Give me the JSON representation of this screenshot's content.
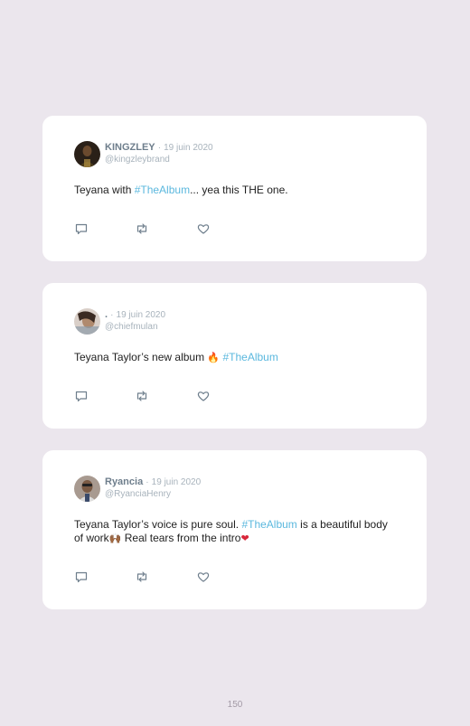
{
  "tweets": [
    {
      "name": "KINGZLEY",
      "separator": "·",
      "date": "19 juin 2020",
      "handle": "@kingzleybrand",
      "text_before": "Teyana with ",
      "hashtag": "#TheAlbum",
      "text_after": "... yea this THE one.",
      "avatar_color": "#2a2018"
    },
    {
      "name": ".",
      "separator": "·",
      "date": "19 juin 2020",
      "handle": "@chiefmulan",
      "text_before": "Teyana Taylor’s new album ",
      "emoji": "🔥",
      "hashtag": "#TheAlbum",
      "avatar_color": "#b8a79c"
    },
    {
      "name": "Ryancia",
      "separator": "·",
      "date": "19 juin 2020",
      "handle": "@RyanciaHenry",
      "text_before": "Teyana Taylor’s voice is pure soul. ",
      "hashtag": "#TheAlbum",
      "text_after": " is a beautiful body of work",
      "emoji_hands": "🙌🏾",
      "text_end": " Real tears from the intro",
      "emoji_heart": "❤",
      "avatar_color": "#8a7a70"
    }
  ],
  "page_number": "150",
  "colors": {
    "background": "#ebe6ed",
    "card": "#ffffff",
    "hashtag": "#5bb8de",
    "name": "#6e7e8c",
    "meta": "#a8b3bc",
    "icons": "#6e7e8c"
  },
  "icons": [
    "reply-icon",
    "retweet-icon",
    "like-icon"
  ]
}
